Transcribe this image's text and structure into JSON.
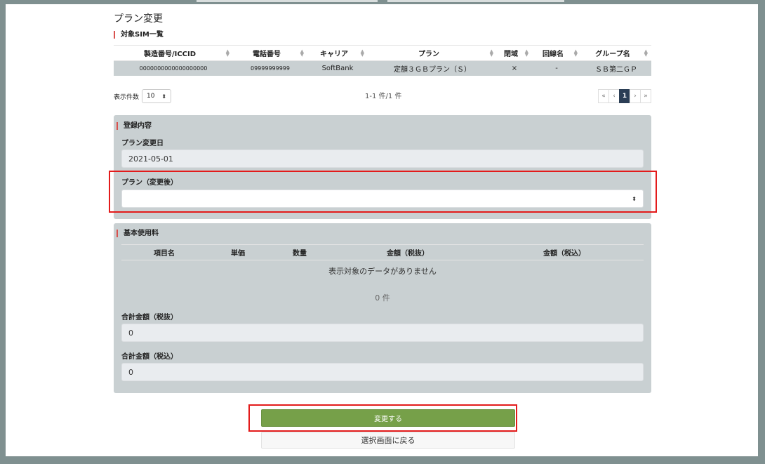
{
  "page": {
    "title": "プラン変更"
  },
  "sim_list": {
    "title": "対象SIM一覧",
    "columns": [
      "製造番号/ICCID",
      "電話番号",
      "キャリア",
      "プラン",
      "閉域",
      "回線名",
      "グループ名"
    ],
    "rows": [
      [
        "0000000000000000000",
        "09999999999",
        "SoftBank",
        "定額３ＧＢプラン（Ｓ）",
        "×",
        "-",
        "ＳＢ第二ＧＰ"
      ]
    ],
    "per_page_label": "表示件数",
    "per_page_value": "10",
    "count_text": "1-1 件/1 件",
    "pager": {
      "first": "«",
      "prev": "‹",
      "current": "1",
      "next": "›",
      "last": "»"
    }
  },
  "registration": {
    "title": "登録内容",
    "change_date_label": "プラン変更日",
    "change_date_value": "2021-05-01",
    "plan_after_label": "プラン（変更後）",
    "plan_after_value": ""
  },
  "basic_fee": {
    "title": "基本使用料",
    "columns": [
      "項目名",
      "単価",
      "数量",
      "金額（税抜）",
      "金額（税込）"
    ],
    "empty_message": "表示対象のデータがありません",
    "count_text": "0 件",
    "total_excl_label": "合計金額（税抜）",
    "total_excl_value": "0",
    "total_incl_label": "合計金額（税込）",
    "total_incl_value": "0"
  },
  "actions": {
    "submit_label": "変更する",
    "back_label": "選択画面に戻る"
  },
  "colors": {
    "submit_button": "#76a049",
    "highlight_frame": "#e31b1b",
    "section_marker": "#d9534f",
    "pager_active": "#2b3e55"
  }
}
